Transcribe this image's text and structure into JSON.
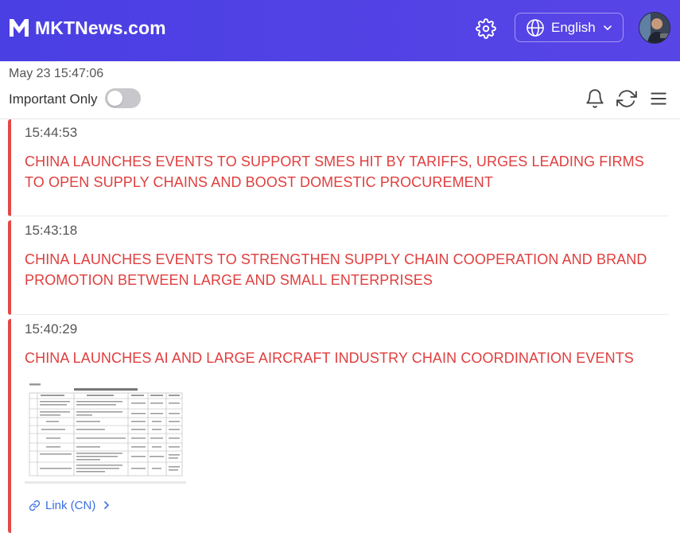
{
  "header": {
    "logo_text": "MKTNews.com",
    "language": "English",
    "icons": [
      "mktnews-logo-icon",
      "gear-icon",
      "globe-icon",
      "chevron-down-icon",
      "avatar"
    ]
  },
  "toolbar": {
    "datetime": "May 23 15:47:06",
    "important_only_label": "Important Only",
    "important_only_enabled": false,
    "icons": [
      "bell-icon",
      "refresh-icon",
      "menu-icon"
    ]
  },
  "news": [
    {
      "time": "15:44:53",
      "headline": "CHINA LAUNCHES EVENTS TO SUPPORT SMES HIT BY TARIFFS, URGES LEADING FIRMS TO OPEN SUPPLY CHAINS AND BOOST DOMESTIC PROCUREMENT"
    },
    {
      "time": "15:43:18",
      "headline": "CHINA LAUNCHES EVENTS TO STRENGTHEN SUPPLY CHAIN COOPERATION AND BRAND PROMOTION BETWEEN LARGE AND SMALL ENTERPRISES"
    },
    {
      "time": "15:40:29",
      "headline": "CHINA LAUNCHES AI AND LARGE AIRCRAFT INDUSTRY CHAIN COORDINATION EVENTS",
      "link_label": "Link (CN)"
    }
  ],
  "colors": {
    "header_bg": "#4f3fe0",
    "important_red": "#e03e3e",
    "link_blue": "#3b6fe0"
  }
}
